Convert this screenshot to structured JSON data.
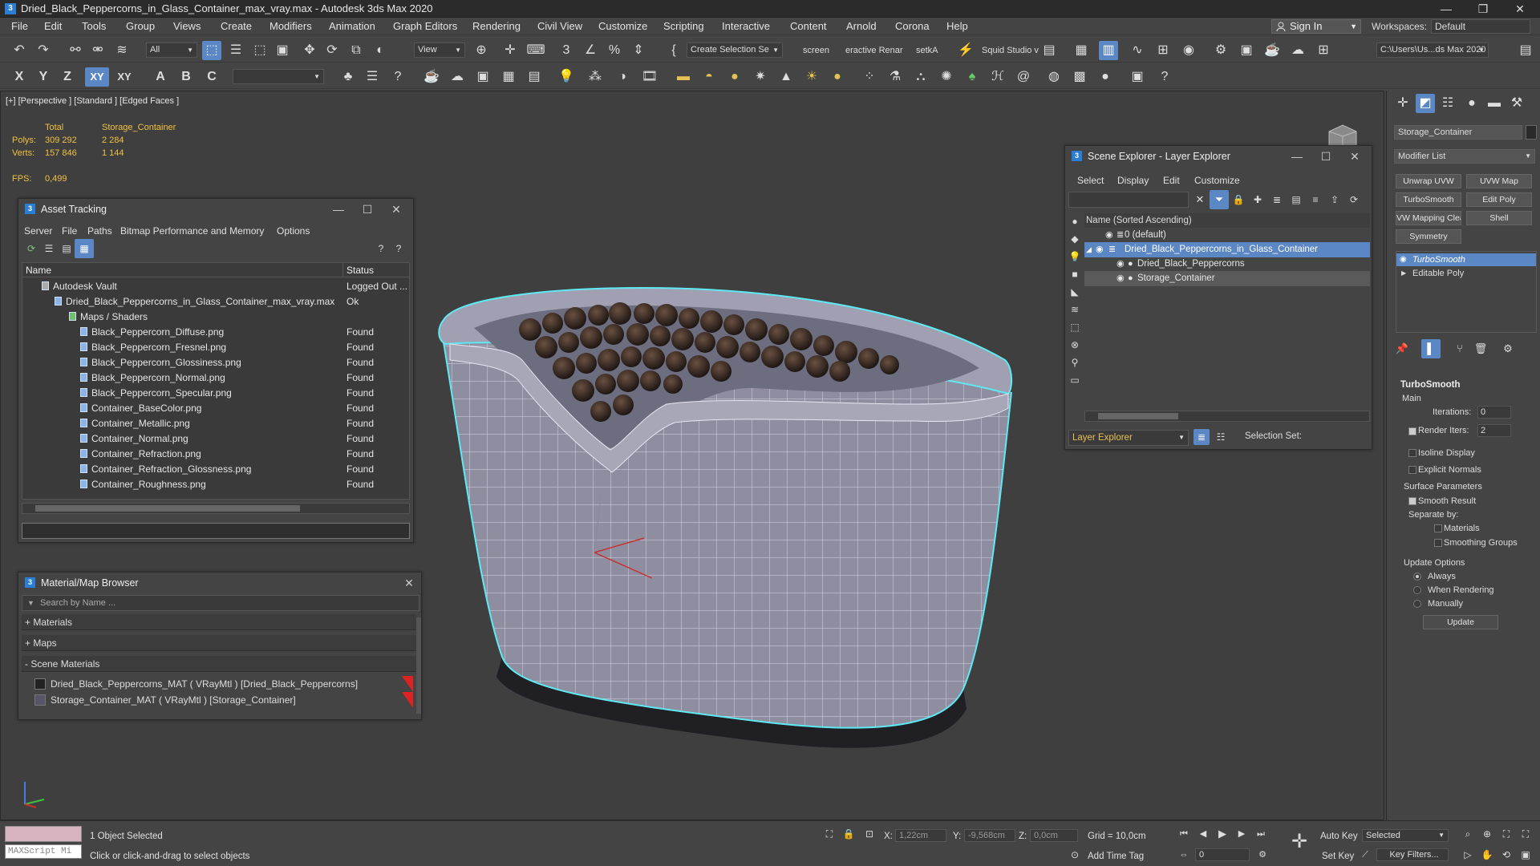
{
  "window": {
    "title": "Dried_Black_Peppercorns_in_Glass_Container_max_vray.max - Autodesk 3ds Max 2020",
    "min": "—",
    "max": "❐",
    "close": "✕"
  },
  "menu": [
    "File",
    "Edit",
    "Tools",
    "Group",
    "Views",
    "Create",
    "Modifiers",
    "Animation",
    "Graph Editors",
    "Rendering",
    "Civil View",
    "Customize",
    "Scripting",
    "Interactive",
    "Content",
    "Arnold",
    "Corona",
    "Help"
  ],
  "account": {
    "signin": "Sign In",
    "workspaces_label": "Workspaces:",
    "workspace": "Default"
  },
  "toolbar1": {
    "filter": "All",
    "view": "View",
    "create_selection_set": "Create Selection Se",
    "tab_screen": "screen",
    "tab_interactive_render": "eractive Renar",
    "tab_setka": "setkA",
    "squid_studio": "Squid Studio v",
    "project_path": "C:\\Users\\Us...ds Max 2020"
  },
  "toolbar2": {
    "axis_x": "X",
    "axis_y": "Y",
    "axis_z": "Z",
    "axis_xy": "XY",
    "axis_xy2": "XY"
  },
  "viewport": {
    "label": "[+] [Perspective ] [Standard ] [Edged Faces ]",
    "stats": {
      "total_label": "Total",
      "object_label": "Storage_Container",
      "polys_label": "Polys:",
      "polys_total": "309 292",
      "polys_obj": "2 284",
      "verts_label": "Verts:",
      "verts_total": "157 846",
      "verts_obj": "1 144",
      "fps_label": "FPS:",
      "fps": "0,499"
    }
  },
  "asset_tracking": {
    "title": "Asset Tracking",
    "menu": [
      "Server",
      "File",
      "Paths",
      "Bitmap Performance and Memory",
      "Options"
    ],
    "col_name": "Name",
    "col_status": "Status",
    "rows": [
      {
        "name": "Autodesk Vault",
        "status": "Logged Out ..."
      },
      {
        "name": "Dried_Black_Peppercorns_in_Glass_Container_max_vray.max",
        "status": "Ok"
      },
      {
        "name": "Maps / Shaders",
        "status": ""
      },
      {
        "name": "Black_Peppercorn_Diffuse.png",
        "status": "Found"
      },
      {
        "name": "Black_Peppercorn_Fresnel.png",
        "status": "Found"
      },
      {
        "name": "Black_Peppercorn_Glossiness.png",
        "status": "Found"
      },
      {
        "name": "Black_Peppercorn_Normal.png",
        "status": "Found"
      },
      {
        "name": "Black_Peppercorn_Specular.png",
        "status": "Found"
      },
      {
        "name": "Container_BaseColor.png",
        "status": "Found"
      },
      {
        "name": "Container_Metallic.png",
        "status": "Found"
      },
      {
        "name": "Container_Normal.png",
        "status": "Found"
      },
      {
        "name": "Container_Refraction.png",
        "status": "Found"
      },
      {
        "name": "Container_Refraction_Glossness.png",
        "status": "Found"
      },
      {
        "name": "Container_Roughness.png",
        "status": "Found"
      }
    ]
  },
  "material_browser": {
    "title": "Material/Map Browser",
    "search_placeholder": "Search by Name ...",
    "groups": [
      "+ Materials",
      "+ Maps",
      "- Scene Materials"
    ],
    "items": [
      "Dried_Black_Peppercorns_MAT  ( VRayMtl )  [Dried_Black_Peppercorns]",
      "Storage_Container_MAT  ( VRayMtl )  [Storage_Container]"
    ]
  },
  "scene_explorer": {
    "title": "Scene Explorer - Layer Explorer",
    "menu": [
      "Select",
      "Display",
      "Edit",
      "Customize"
    ],
    "header": "Name (Sorted Ascending)",
    "rows": [
      "0 (default)",
      "Dried_Black_Peppercorns_in_Glass_Container",
      "Dried_Black_Peppercorns",
      "Storage_Container"
    ],
    "footer_dropdown": "Layer Explorer",
    "selection_set": "Selection Set:"
  },
  "command_panel": {
    "object_name": "Storage_Container",
    "modifier_list": "Modifier List",
    "buttons": [
      "Unwrap UVW",
      "UVW Map",
      "TurboSmooth",
      "Edit Poly",
      "VW Mapping Clea",
      "Shell",
      "Symmetry"
    ],
    "stack": [
      "TurboSmooth",
      "Editable Poly"
    ],
    "turbosmooth": {
      "title": "TurboSmooth",
      "main": "Main",
      "iterations_label": "Iterations:",
      "iterations": "0",
      "render_iters_label": "Render Iters:",
      "render_iters": "2",
      "isoline": "Isoline Display",
      "explicit_normals": "Explicit Normals",
      "surface_params": "Surface Parameters",
      "smooth_result": "Smooth Result",
      "separate_by": "Separate by:",
      "materials": "Materials",
      "smoothing_groups": "Smoothing Groups",
      "update_options": "Update Options",
      "always": "Always",
      "when_rendering": "When Rendering",
      "manually": "Manually",
      "update": "Update"
    }
  },
  "status": {
    "selected": "1 Object Selected",
    "hint": "Click or click-and-drag to select objects",
    "maxscript": "MAXScript Mi",
    "x_label": "X:",
    "x": "1,22cm",
    "y_label": "Y:",
    "y": "-9,568cm",
    "z_label": "Z:",
    "z": "0,0cm",
    "grid": "Grid = 10,0cm",
    "add_time_tag": "Add Time Tag",
    "frame": "0",
    "auto_key": "Auto Key",
    "selected_dropdown": "Selected",
    "set_key": "Set Key",
    "key_filters": "Key Filters..."
  }
}
